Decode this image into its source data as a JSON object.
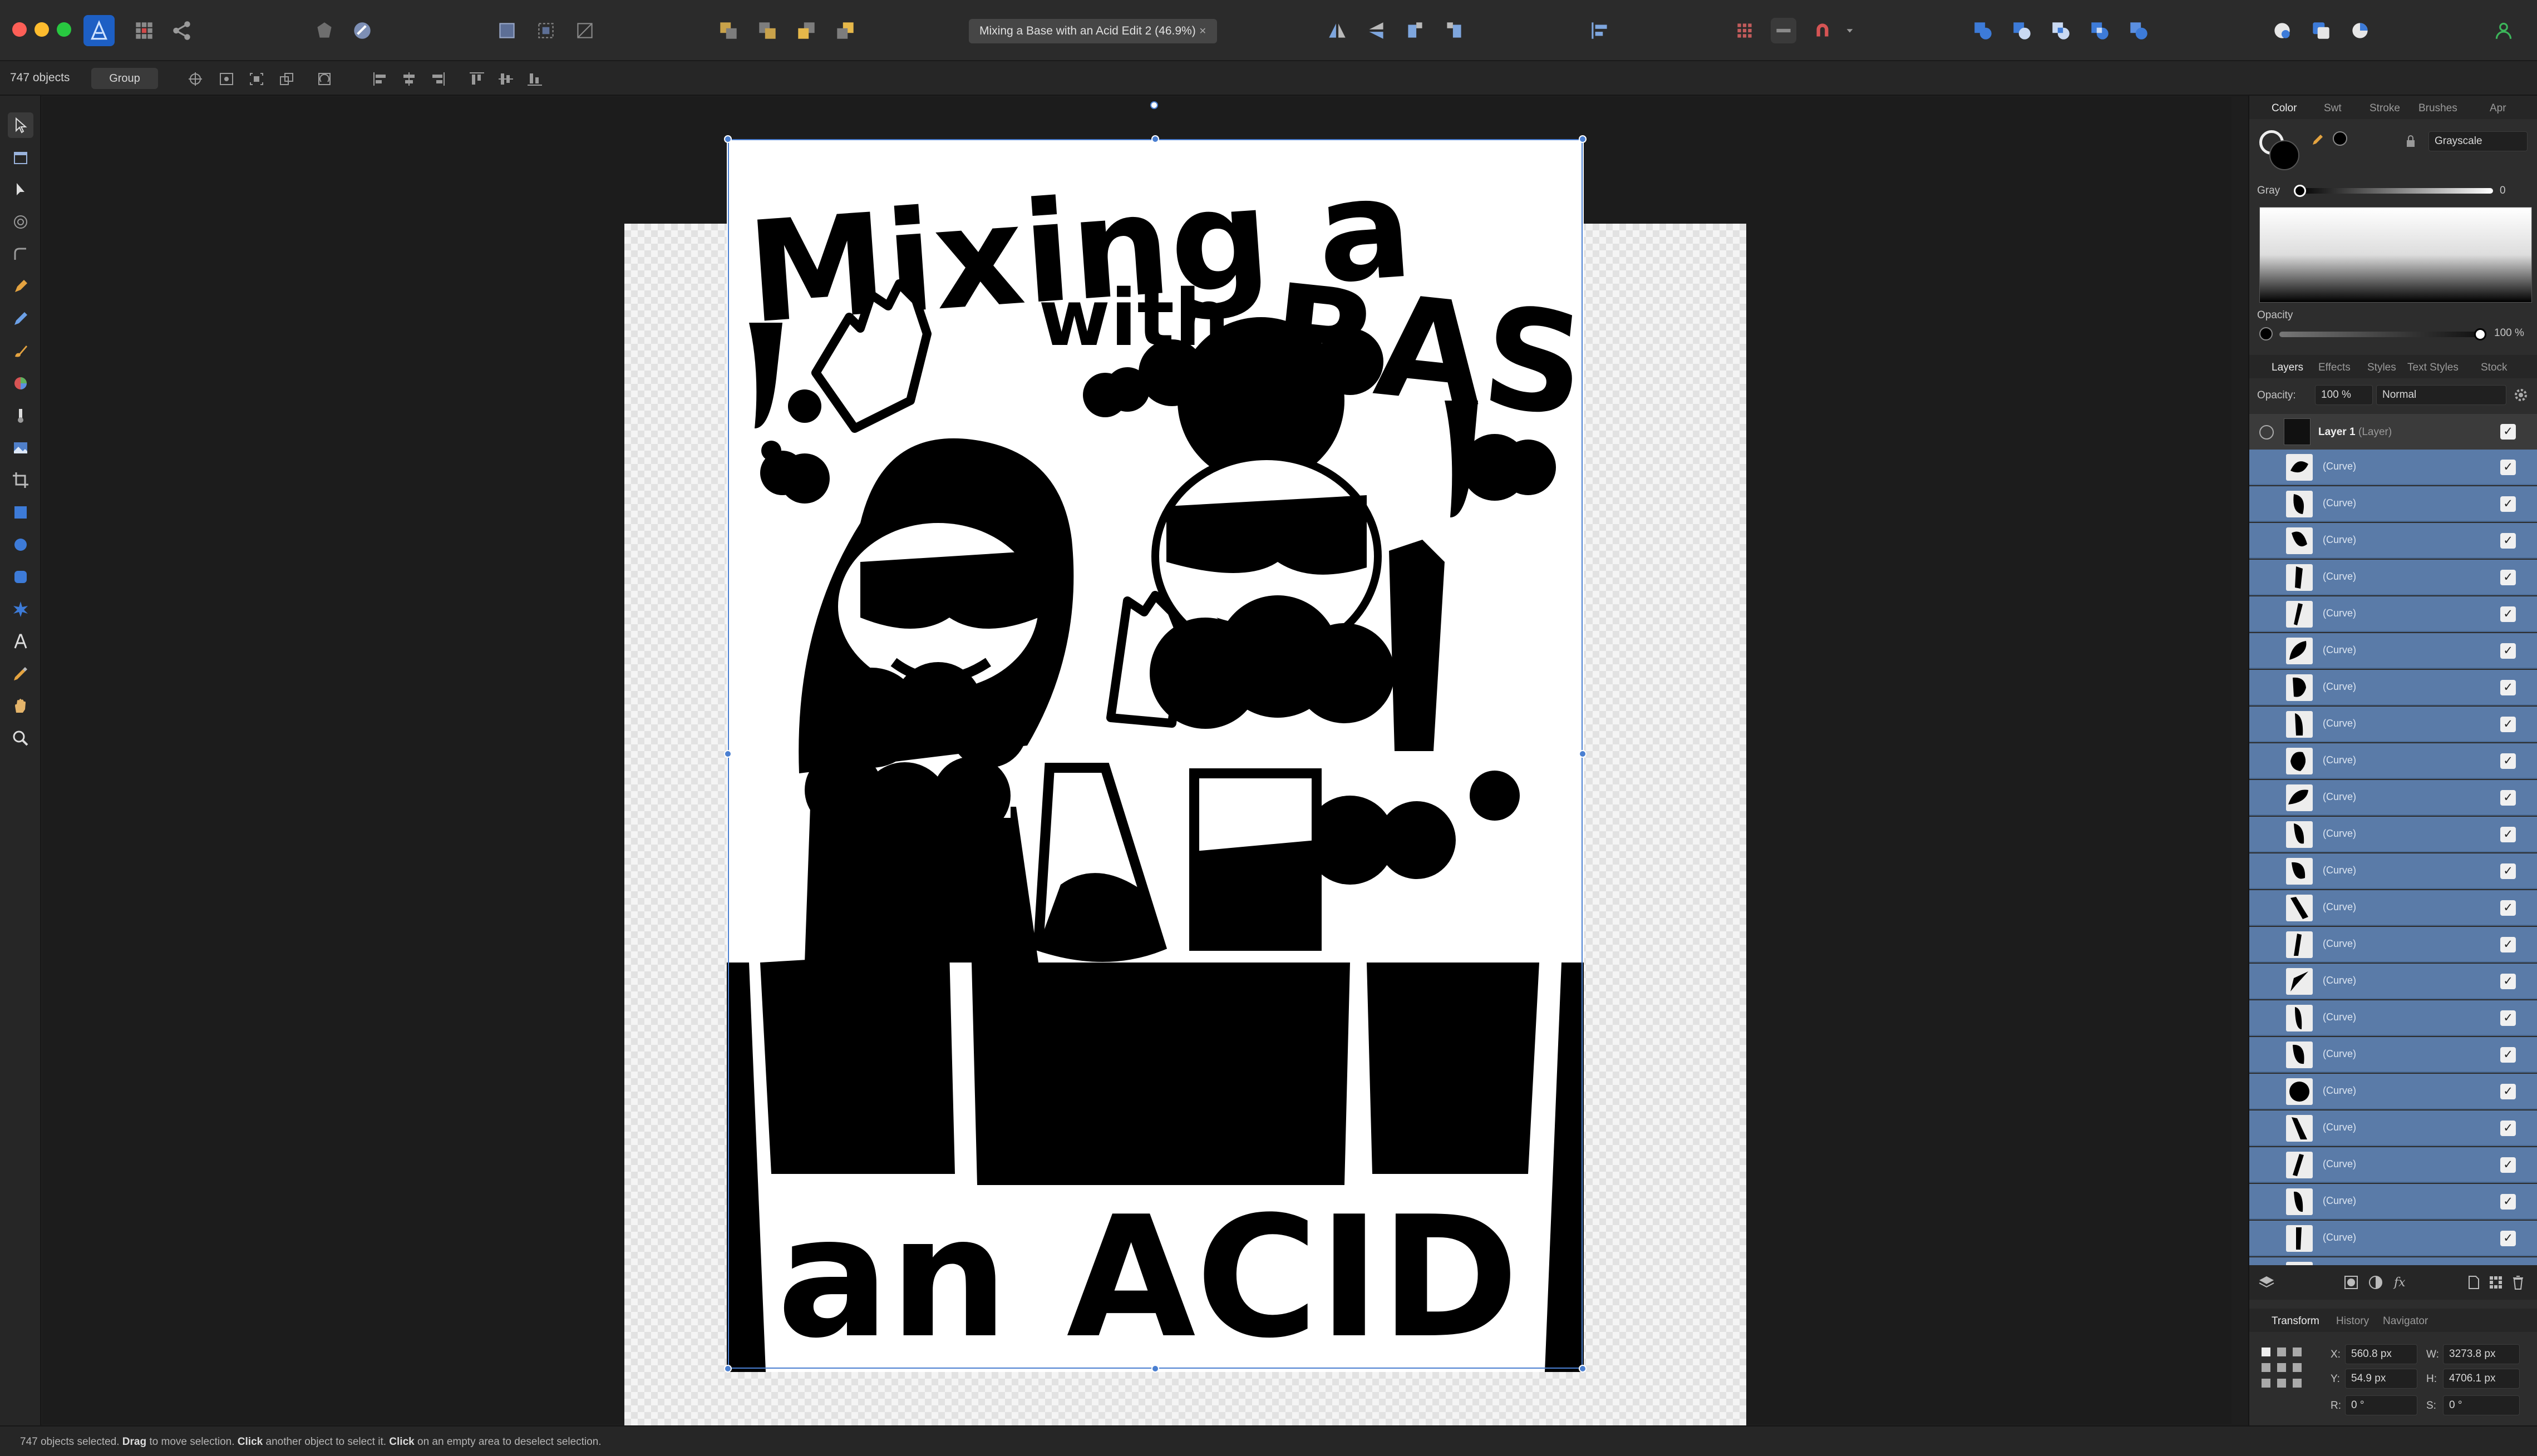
{
  "window": {
    "doc_title": "Mixing a Base with an Acid Edit 2 (46.9%)",
    "close_symbol": "✕"
  },
  "context": {
    "object_count": "747 objects",
    "group_label": "Group"
  },
  "status": {
    "p1": "747 objects selected. ",
    "k1": "Drag",
    "p2": " to move selection. ",
    "k2": "Click",
    "p3": " another object to select it. ",
    "k3": "Click",
    "p4": " on an empty area to deselect selection."
  },
  "poster": {
    "title_top": "Mixing a",
    "title_mid": "with",
    "title_big": "BASE",
    "title_bottom": "an ACID"
  },
  "color_panel": {
    "tabs": [
      "Color",
      "Swt",
      "Stroke",
      "Brushes",
      "Apr"
    ],
    "mode": "Grayscale",
    "gray_label": "Gray",
    "gray_value": "0",
    "opacity_label": "Opacity",
    "opacity_value": "100 %"
  },
  "layers_panel": {
    "tabs": [
      "Layers",
      "Effects",
      "Styles",
      "Text Styles",
      "Stock"
    ],
    "opacity_label": "Opacity:",
    "opacity_value": "100 %",
    "blend_mode": "Normal",
    "layer_name": "Layer 1",
    "layer_type": "(Layer)",
    "curve_label": "(Curve)",
    "check_symbol": "✓"
  },
  "transform_panel": {
    "tabs": [
      "Transform",
      "History",
      "Navigator"
    ],
    "x_label": "X:",
    "x_value": "560.8 px",
    "y_label": "Y:",
    "y_value": "54.9 px",
    "w_label": "W:",
    "w_value": "3273.8 px",
    "h_label": "H:",
    "h_value": "4706.1 px",
    "r_label": "R:",
    "r_value": "0 °",
    "s_label": "S:",
    "s_value": "0 °"
  },
  "colors": {
    "selection": "#4a7fd1",
    "layer_highlight": "#5a7ba8",
    "accent": "#3d7bd8"
  }
}
